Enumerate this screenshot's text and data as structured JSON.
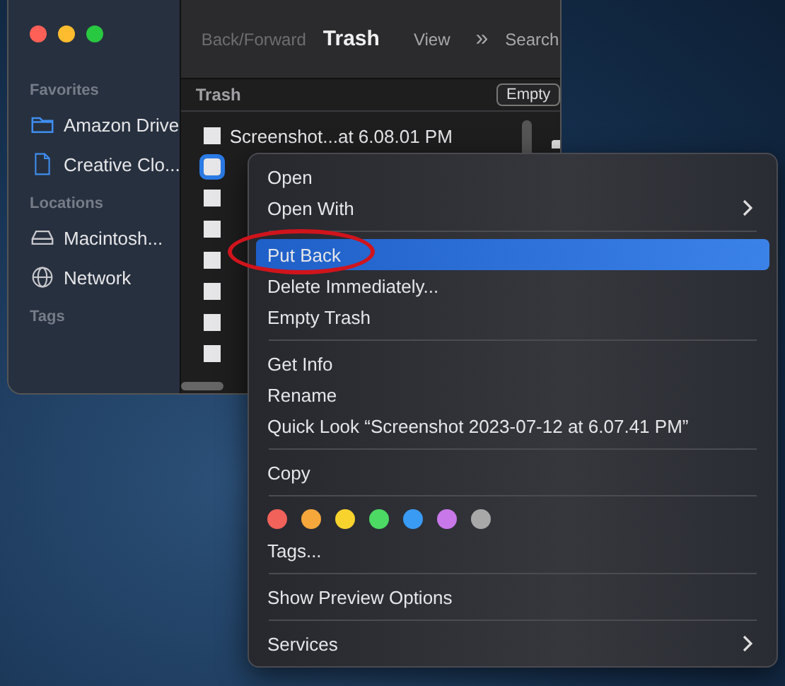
{
  "window": {
    "toolbar": {
      "nav": "Back/Forward",
      "title": "Trash",
      "view": "View",
      "more": "»",
      "search": "Search"
    }
  },
  "sidebar": {
    "sections": [
      {
        "heading": "Favorites",
        "items": [
          {
            "label": "Amazon Drive",
            "kind": "folder"
          },
          {
            "label": "Creative Clo...",
            "kind": "document"
          }
        ]
      },
      {
        "heading": "Locations",
        "items": [
          {
            "label": "Macintosh...",
            "kind": "drive"
          },
          {
            "label": "Network",
            "kind": "network"
          }
        ]
      },
      {
        "heading": "Tags"
      }
    ]
  },
  "path_bar": {
    "title": "Trash",
    "button": "Empty"
  },
  "files": [
    {
      "name": "Screenshot...at 6.08.01 PM",
      "selected": false
    },
    {
      "selected": true
    },
    {
      "selected": false
    },
    {
      "selected": false
    },
    {
      "selected": false
    },
    {
      "selected": false
    },
    {
      "selected": false
    },
    {
      "selected": false
    }
  ],
  "context_menu": {
    "groups": [
      {
        "items": [
          {
            "kind": "item",
            "label": "Open",
            "selected": false,
            "submenu": false,
            "circled": false
          },
          {
            "kind": "item",
            "label": "Open With",
            "selected": false,
            "submenu": true,
            "circled": false
          }
        ]
      },
      {
        "items": [
          {
            "kind": "item",
            "label": "Put Back",
            "selected": true,
            "submenu": false,
            "circled": true
          },
          {
            "kind": "item",
            "label": "Delete Immediately...",
            "selected": false,
            "submenu": false,
            "circled": false
          },
          {
            "kind": "item",
            "label": "Empty Trash",
            "selected": false,
            "submenu": false,
            "circled": false
          }
        ]
      },
      {
        "items": [
          {
            "kind": "item",
            "label": "Get Info",
            "selected": false,
            "submenu": false,
            "circled": false
          },
          {
            "kind": "item",
            "label": "Rename",
            "selected": false,
            "submenu": false,
            "circled": false
          },
          {
            "kind": "item",
            "label": "Quick Look “Screenshot 2023-07-12 at 6.07.41 PM”",
            "selected": false,
            "submenu": false,
            "circled": false
          }
        ]
      },
      {
        "items": [
          {
            "kind": "item",
            "label": "Copy",
            "selected": false,
            "submenu": false,
            "circled": false
          }
        ]
      },
      {
        "items": [
          {
            "kind": "tags",
            "tags": [
              {
                "color": "#f0625a"
              },
              {
                "color": "#f5a73b"
              },
              {
                "color": "#f8d32e"
              },
              {
                "color": "#4cd964"
              },
              {
                "color": "#3a9bf5"
              },
              {
                "color": "#c878e8"
              },
              {
                "color": "#a8a8a8"
              }
            ]
          },
          {
            "kind": "item",
            "label": "Tags...",
            "selected": false,
            "submenu": false,
            "circled": false
          }
        ]
      },
      {
        "items": [
          {
            "kind": "item",
            "label": "Show Preview Options",
            "selected": false,
            "submenu": false,
            "circled": false
          }
        ]
      },
      {
        "items": [
          {
            "kind": "item",
            "label": "Services",
            "selected": false,
            "submenu": true,
            "circled": false
          }
        ]
      }
    ]
  }
}
